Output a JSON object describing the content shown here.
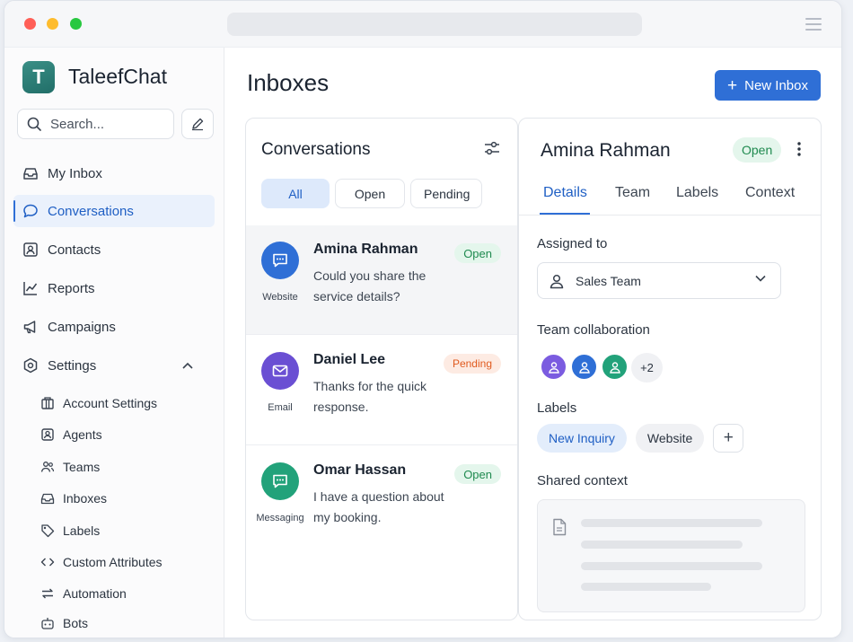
{
  "app": {
    "brand_initial": "T",
    "brand_name": "TaleefChat",
    "accent_color": "#2f6fd6"
  },
  "sidebar": {
    "search_placeholder": "Search...",
    "nav": [
      {
        "label": "My Inbox",
        "icon": "inbox-icon"
      },
      {
        "label": "Conversations",
        "icon": "chat-bubble-icon",
        "active": true
      },
      {
        "label": "Contacts",
        "icon": "contact-card-icon"
      },
      {
        "label": "Reports",
        "icon": "line-chart-icon"
      },
      {
        "label": "Campaigns",
        "icon": "megaphone-icon"
      },
      {
        "label": "Settings",
        "icon": "gear-icon",
        "expanded": true
      }
    ],
    "settings_items": [
      {
        "label": "Account Settings",
        "icon": "building-icon"
      },
      {
        "label": "Agents",
        "icon": "agent-icon"
      },
      {
        "label": "Teams",
        "icon": "team-icon"
      },
      {
        "label": "Inboxes",
        "icon": "inbox-icon"
      },
      {
        "label": "Labels",
        "icon": "tag-icon"
      },
      {
        "label": "Custom Attributes",
        "icon": "code-brackets-icon"
      },
      {
        "label": "Automation",
        "icon": "swap-arrows-icon"
      },
      {
        "label": "Bots",
        "icon": "bot-icon"
      }
    ]
  },
  "main": {
    "title": "Inboxes",
    "new_inbox_label": "New Inbox"
  },
  "conversations": {
    "title": "Conversations",
    "filters": [
      "All",
      "Open",
      "Pending"
    ],
    "selected_filter": "All",
    "items": [
      {
        "name": "Amina Rahman",
        "message": "Could you share the service details?",
        "channel": "Website",
        "status": "Open",
        "avatar_color": "#2f6fd6",
        "icon": "chat-icon",
        "selected": true
      },
      {
        "name": "Daniel Lee",
        "message": "Thanks for the quick response.",
        "channel": "Email",
        "status": "Pending",
        "avatar_color": "#6a4fd3",
        "icon": "envelope-icon"
      },
      {
        "name": "Omar Hassan",
        "message": "I have a question about my booking.",
        "channel": "Messaging",
        "status": "Open",
        "avatar_color": "#22a27a",
        "icon": "chat-icon"
      }
    ]
  },
  "details": {
    "contact_name": "Amina Rahman",
    "status": "Open",
    "tabs": [
      "Details",
      "Team",
      "Labels",
      "Context"
    ],
    "selected_tab": "Details",
    "assigned_label": "Assigned to",
    "assigned_value": "Sales Team",
    "team_label": "Team collaboration",
    "team_more": "+2",
    "labels_label": "Labels",
    "labels": [
      "New Inquiry",
      "Website"
    ],
    "add_label": "+",
    "shared_label": "Shared context"
  }
}
